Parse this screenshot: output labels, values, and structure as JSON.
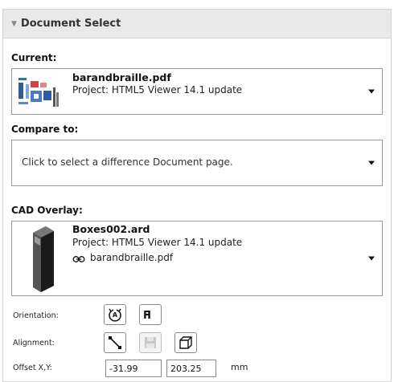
{
  "panel": {
    "title": "Document Select"
  },
  "current": {
    "label": "Current:",
    "file_name": "barandbraille.pdf",
    "project": "Project: HTML5 Viewer 14.1 update"
  },
  "compare": {
    "label": "Compare to:",
    "placeholder": "Click to select a difference Document page."
  },
  "cad_overlay": {
    "label": "CAD Overlay:",
    "file_name": "Boxes002.ard",
    "project": "Project: HTML5 Viewer 14.1 update",
    "linked_file": "barandbraille.pdf"
  },
  "orientation": {
    "label": "Orientation:",
    "icons": [
      "rotate-icon",
      "flip-icon"
    ]
  },
  "alignment": {
    "label": "Alignment:",
    "icons": [
      "align-diagonal-icon",
      "align-save-icon",
      "align-3d-box-icon"
    ]
  },
  "offset": {
    "label": "Offset X,Y:",
    "x": "-31.99",
    "y": "203.25",
    "unit": "mm"
  }
}
